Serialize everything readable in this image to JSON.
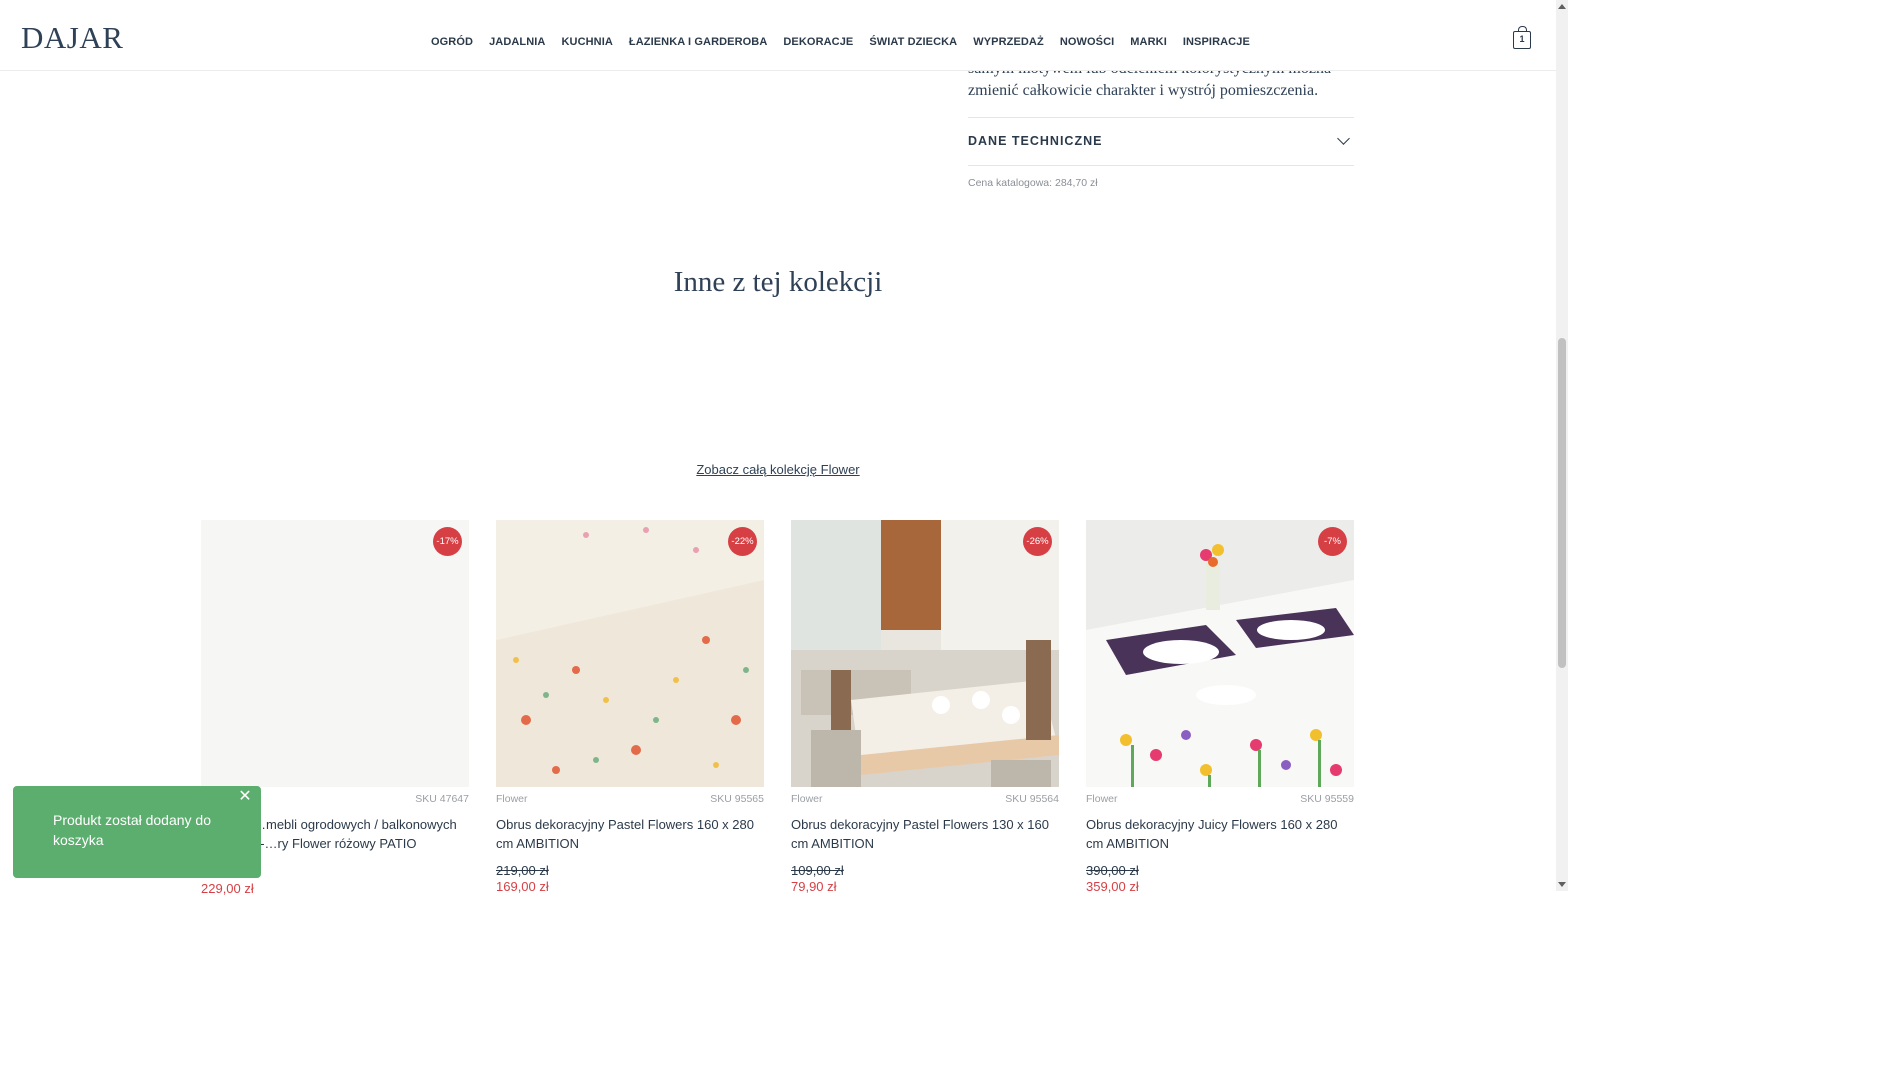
{
  "header": {
    "logo": "DAJAR",
    "nav": [
      "OGRÓD",
      "JADALNIA",
      "KUCHNIA",
      "ŁAZIENKA I GARDEROBA",
      "DEKORACJE",
      "ŚWIAT DZIECKA",
      "WYPRZEDAŻ",
      "NOWOŚCI",
      "MARKI",
      "INSPIRACJE"
    ],
    "cart_count": "1",
    "cart_icon": "shopping-bag-icon"
  },
  "product": {
    "description_tail": "samym motywem lub odcieniem kolorystycznym można zmienić całkowicie charakter i wystrój pomieszczenia.",
    "accordion_label": "DANE TECHNICZNE",
    "catalog_price": "Cena katalogowa: 284,70 zł"
  },
  "collection": {
    "title": "Inne z tej kolekcji",
    "link": "Zobacz całą kolekcję Flower"
  },
  "cards": [
    {
      "badge": "-17%",
      "brand": "",
      "sku": "SKU 47647",
      "name": "…mebli ogrodowych / balkonowych 4-…ry Flower różowy PATIO",
      "old_price": "",
      "price": "229,00 zł"
    },
    {
      "badge": "-22%",
      "brand": "Flower",
      "sku": "SKU 95565",
      "name": "Obrus dekoracyjny Pastel Flowers 160 x 280 cm AMBITION",
      "old_price": "219,00 zł",
      "price": "169,00 zł"
    },
    {
      "badge": "-26%",
      "brand": "Flower",
      "sku": "SKU 95564",
      "name": "Obrus dekoracyjny Pastel Flowers 130 x 160 cm AMBITION",
      "old_price": "109,00 zł",
      "price": "79,90 zł"
    },
    {
      "badge": "-7%",
      "brand": "Flower",
      "sku": "SKU 95559",
      "name": "Obrus dekoracyjny Juicy Flowers 160 x 280 cm AMBITION",
      "old_price": "390,00 zł",
      "price": "359,00 zł"
    }
  ],
  "toast": {
    "message": "Produkt został dodany do koszyka",
    "close_icon": "close-icon",
    "color": "#5cae6e"
  },
  "colors": {
    "accent": "#d64045",
    "text": "#2b3a4a"
  }
}
